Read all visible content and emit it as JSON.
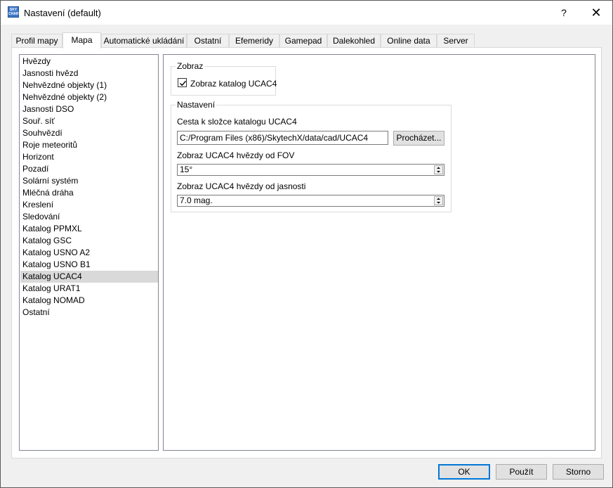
{
  "window": {
    "title": "Nastavení (default)",
    "help_symbol": "?",
    "close_symbol": "✕",
    "app_icon_text": "SKY CHART"
  },
  "tabs": [
    {
      "label": "Profil mapy",
      "active": false
    },
    {
      "label": "Mapa",
      "active": true
    },
    {
      "label": "Automatické ukládání",
      "active": false
    },
    {
      "label": "Ostatní",
      "active": false
    },
    {
      "label": "Efemeridy",
      "active": false
    },
    {
      "label": "Gamepad",
      "active": false
    },
    {
      "label": "Dalekohled",
      "active": false
    },
    {
      "label": "Online data",
      "active": false
    },
    {
      "label": "Server",
      "active": false
    }
  ],
  "nav": {
    "items": [
      {
        "label": "Hvězdy",
        "selected": false
      },
      {
        "label": "Jasnosti hvězd",
        "selected": false
      },
      {
        "label": "Nehvězdné objekty (1)",
        "selected": false
      },
      {
        "label": "Nehvězdné objekty (2)",
        "selected": false
      },
      {
        "label": "Jasnosti DSO",
        "selected": false
      },
      {
        "label": "Souř. síť",
        "selected": false
      },
      {
        "label": "Souhvězdí",
        "selected": false
      },
      {
        "label": "Roje meteoritů",
        "selected": false
      },
      {
        "label": "Horizont",
        "selected": false
      },
      {
        "label": "Pozadí",
        "selected": false
      },
      {
        "label": "Solární systém",
        "selected": false
      },
      {
        "label": "Mléčná dráha",
        "selected": false
      },
      {
        "label": "Kreslení",
        "selected": false
      },
      {
        "label": "Sledování",
        "selected": false
      },
      {
        "label": "Katalog PPMXL",
        "selected": false
      },
      {
        "label": "Katalog GSC",
        "selected": false
      },
      {
        "label": "Katalog USNO A2",
        "selected": false
      },
      {
        "label": "Katalog USNO B1",
        "selected": false
      },
      {
        "label": "Katalog UCAC4",
        "selected": true
      },
      {
        "label": "Katalog URAT1",
        "selected": false
      },
      {
        "label": "Katalog NOMAD",
        "selected": false
      },
      {
        "label": "Ostatní",
        "selected": false
      }
    ]
  },
  "display_group": {
    "title": "Zobraz",
    "show_catalog_label": "Zobraz katalog UCAC4",
    "show_catalog_checked": true
  },
  "settings_group": {
    "title": "Nastavení",
    "path_label": "Cesta k složce katalogu UCAC4",
    "path_value": "C:/Program Files (x86)/SkytechX/data/cad/UCAC4",
    "browse_label": "Procházet...",
    "fov_label": "Zobraz UCAC4 hvězdy od FOV",
    "fov_value": "15°",
    "mag_label": "Zobraz UCAC4 hvězdy od jasnosti",
    "mag_value": "7.0 mag."
  },
  "footer": {
    "ok_label": "OK",
    "apply_label": "Použít",
    "cancel_label": "Storno"
  }
}
